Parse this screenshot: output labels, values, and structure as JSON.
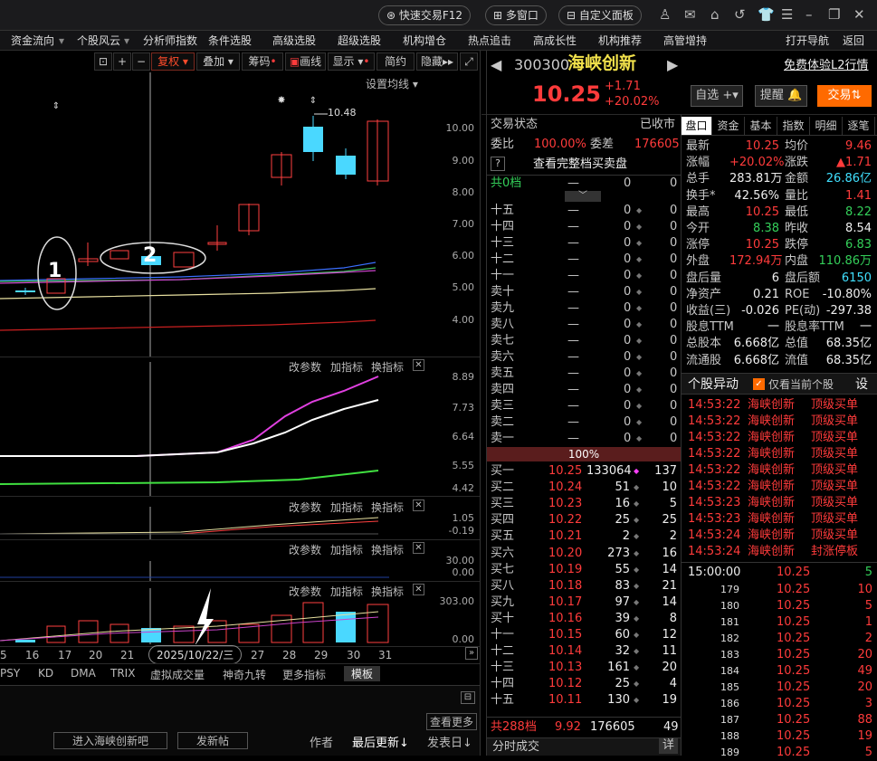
{
  "topbar": {
    "quick_trade": "快速交易F12",
    "multi_window": "多窗口",
    "custom_panel": "自定义面板"
  },
  "nav": {
    "items": [
      "资金流向",
      "个股风云",
      "分析师指数",
      "条件选股",
      "高级选股",
      "超级选股",
      "机构增仓",
      "热点追击",
      "高成长性",
      "机构推荐",
      "高管增持"
    ],
    "open_nav": "打开导航",
    "back": "返回"
  },
  "chart_toolbar": {
    "fuquan": "复权",
    "overlay": "叠加",
    "chips": "筹码",
    "draw": "画线",
    "display": "显示",
    "simple": "简约",
    "hide": "隐藏"
  },
  "chart": {
    "ma_setting": "设置均线",
    "price_levels": [
      "10.00",
      "9.00",
      "8.00",
      "7.00",
      "6.00",
      "5.00",
      "4.00"
    ],
    "high_label": "10.48",
    "circle1": "1",
    "circle2": "2",
    "ind1_levels": [
      "8.89",
      "7.73",
      "6.64",
      "5.55",
      "4.42"
    ],
    "ind2_levels": [
      "1.05",
      "-0.19"
    ],
    "ind3_levels": [
      "30.00",
      "0.00"
    ],
    "vol_levels": [
      "303.00",
      "0.00"
    ],
    "panel_links": {
      "params": "改参数",
      "add": "加指标",
      "swap": "换指标"
    },
    "dates": [
      "5",
      "16",
      "17",
      "20",
      "21",
      "2025/10/22/三",
      "27",
      "28",
      "29",
      "30",
      "31"
    ],
    "indicator_tabs": [
      "PSY",
      "KD",
      "DMA",
      "TRIX",
      "虚拟成交量",
      "神奇九转",
      "更多指标",
      "模板"
    ]
  },
  "bottom_left": {
    "see_more": "查看更多",
    "enter_forum": "进入海峡创新吧",
    "post": "发新帖",
    "author": "作者",
    "last_update": "最后更新",
    "post_date": "发表日"
  },
  "stock": {
    "code": "300300",
    "name": "海峡创新",
    "l2_link": "免费体验L2行情",
    "price": "10.25",
    "change": "+1.71",
    "pct": "+20.02%",
    "watch": "自选",
    "alert": "提醒",
    "trade": "交易"
  },
  "order_book": {
    "status_label": "交易状态",
    "status": "已收市",
    "weibi_label": "委比",
    "weibi": "100.00%",
    "weicha_label": "委差",
    "weicha": "176605",
    "full_depth": "查看完整档买卖盘",
    "total0": "共0档",
    "center_pct": "100%",
    "asks": [
      {
        "l": "十五"
      },
      {
        "l": "十四"
      },
      {
        "l": "十三"
      },
      {
        "l": "十二"
      },
      {
        "l": "十一"
      },
      {
        "l": "卖十"
      },
      {
        "l": "卖九"
      },
      {
        "l": "卖八"
      },
      {
        "l": "卖七"
      },
      {
        "l": "卖六"
      },
      {
        "l": "卖五"
      },
      {
        "l": "卖四"
      },
      {
        "l": "卖三"
      },
      {
        "l": "卖二"
      },
      {
        "l": "卖一"
      }
    ],
    "bids": [
      {
        "l": "买一",
        "p": "10.25",
        "v": "133064",
        "n": "137"
      },
      {
        "l": "买二",
        "p": "10.24",
        "v": "51",
        "n": "10"
      },
      {
        "l": "买三",
        "p": "10.23",
        "v": "16",
        "n": "5"
      },
      {
        "l": "买四",
        "p": "10.22",
        "v": "25",
        "n": "25"
      },
      {
        "l": "买五",
        "p": "10.21",
        "v": "2",
        "n": "2"
      },
      {
        "l": "买六",
        "p": "10.20",
        "v": "273",
        "n": "16"
      },
      {
        "l": "买七",
        "p": "10.19",
        "v": "55",
        "n": "14"
      },
      {
        "l": "买八",
        "p": "10.18",
        "v": "83",
        "n": "21"
      },
      {
        "l": "买九",
        "p": "10.17",
        "v": "97",
        "n": "14"
      },
      {
        "l": "买十",
        "p": "10.16",
        "v": "39",
        "n": "8"
      },
      {
        "l": "十一",
        "p": "10.15",
        "v": "60",
        "n": "12"
      },
      {
        "l": "十二",
        "p": "10.14",
        "v": "32",
        "n": "11"
      },
      {
        "l": "十三",
        "p": "10.13",
        "v": "161",
        "n": "20"
      },
      {
        "l": "十四",
        "p": "10.12",
        "v": "25",
        "n": "4"
      },
      {
        "l": "十五",
        "p": "10.11",
        "v": "130",
        "n": "19"
      }
    ],
    "total_bid": "共288档",
    "avg_price": "9.92",
    "total_vol": "176605",
    "total_num": "49",
    "fenshi": "分时成交",
    "detail": "详"
  },
  "quote_tabs": [
    "盘口",
    "资金",
    "基本",
    "指数",
    "明细",
    "逐笔"
  ],
  "quote": [
    [
      "最新",
      "10.25",
      "均价",
      "9.46"
    ],
    [
      "涨幅",
      "+20.02%",
      "涨跌",
      "▲1.71"
    ],
    [
      "总手",
      "283.81万",
      "金额",
      "26.86亿"
    ],
    [
      "换手*",
      "42.56%",
      "量比",
      "1.41"
    ],
    [
      "最高",
      "10.25",
      "最低",
      "8.22"
    ],
    [
      "今开",
      "8.38",
      "昨收",
      "8.54"
    ],
    [
      "涨停",
      "10.25",
      "跌停",
      "6.83"
    ],
    [
      "外盘",
      "172.94万",
      "内盘",
      "110.86万"
    ],
    [
      "盘后量",
      "6",
      "盘后额",
      "6150"
    ],
    [
      "净资产",
      "0.21",
      "ROE",
      "-10.80%"
    ],
    [
      "收益(三)",
      "-0.026",
      "PE(动)",
      "-297.38"
    ],
    [
      "股息TTM",
      "一",
      "股息率TTM",
      "一"
    ],
    [
      "总股本",
      "6.668亿",
      "总值",
      "68.35亿"
    ],
    [
      "流通股",
      "6.668亿",
      "流值",
      "68.35亿"
    ]
  ],
  "movers": {
    "title": "个股异动",
    "only_current": "仅看当前个股",
    "settings": "设",
    "rows": [
      [
        "14:53:22",
        "海峡创新",
        "顶级买单"
      ],
      [
        "14:53:22",
        "海峡创新",
        "顶级买单"
      ],
      [
        "14:53:22",
        "海峡创新",
        "顶级买单"
      ],
      [
        "14:53:22",
        "海峡创新",
        "顶级买单"
      ],
      [
        "14:53:22",
        "海峡创新",
        "顶级买单"
      ],
      [
        "14:53:22",
        "海峡创新",
        "顶级买单"
      ],
      [
        "14:53:23",
        "海峡创新",
        "顶级买单"
      ],
      [
        "14:53:23",
        "海峡创新",
        "顶级买单"
      ],
      [
        "14:53:24",
        "海峡创新",
        "顶级买单"
      ],
      [
        "14:53:24",
        "海峡创新",
        "封涨停板"
      ]
    ]
  },
  "ticks": {
    "head": [
      "15:00:00",
      "10.25",
      "5"
    ],
    "rows": [
      [
        "179",
        "10.25",
        "10"
      ],
      [
        "180",
        "10.25",
        "5"
      ],
      [
        "181",
        "10.25",
        "1"
      ],
      [
        "182",
        "10.25",
        "2"
      ],
      [
        "183",
        "10.25",
        "20"
      ],
      [
        "184",
        "10.25",
        "49"
      ],
      [
        "185",
        "10.25",
        "20"
      ],
      [
        "186",
        "10.25",
        "3"
      ],
      [
        "187",
        "10.25",
        "88"
      ],
      [
        "188",
        "10.25",
        "19"
      ],
      [
        "189",
        "10.25",
        "5"
      ]
    ]
  }
}
